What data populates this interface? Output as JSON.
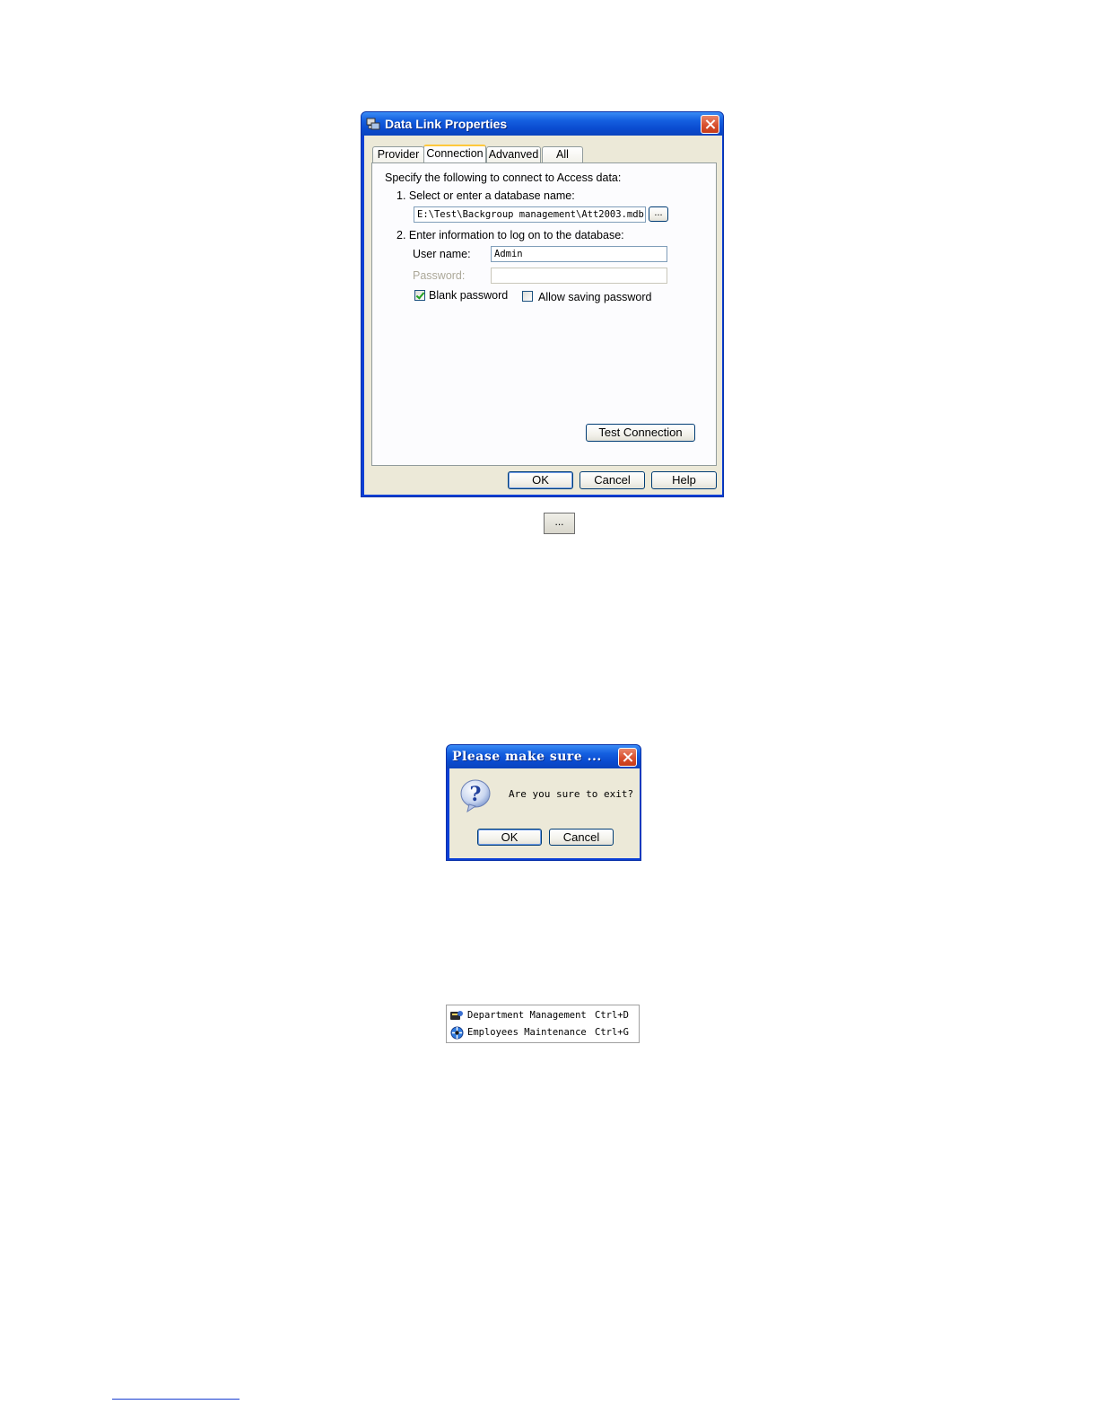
{
  "data_link": {
    "title": "Data Link Properties",
    "tabs": [
      {
        "label": "Provider",
        "active": false
      },
      {
        "label": "Connection",
        "active": true
      },
      {
        "label": "Advanved",
        "active": false
      },
      {
        "label": "All",
        "active": false
      }
    ],
    "intro": "Specify the following to connect to Access data:",
    "step1_label": "1.  Select or enter a database name:",
    "db_path": "E:\\Test\\Backgroup management\\Att2003.mdb",
    "browse_label": "...",
    "step2_label": "2.  Enter information to log on to the database:",
    "username_label": "User name:",
    "username_value": "Admin",
    "password_label": "Password:",
    "password_value": "",
    "blank_password_label": "Blank password",
    "blank_password_checked": true,
    "allow_saving_label": "Allow saving password",
    "allow_saving_checked": false,
    "test_connection_label": "Test Connection",
    "ok_label": "OK",
    "cancel_label": "Cancel",
    "help_label": "Help"
  },
  "standalone_browse_button": {
    "label": "..."
  },
  "confirm_dialog": {
    "title": "Please make sure ...",
    "message": "Are you sure to exit?",
    "ok_label": "OK",
    "cancel_label": "Cancel",
    "icon": "question-icon"
  },
  "menu": {
    "items": [
      {
        "label": "Department Management",
        "shortcut": "Ctrl+D",
        "icon": "department-icon"
      },
      {
        "label": "Employees Maintenance",
        "shortcut": "Ctrl+G",
        "icon": "employees-icon"
      }
    ]
  },
  "colors": {
    "title_bar": "#0a4bd0",
    "dialog_face": "#ece9d8",
    "close_button": "#d8502e",
    "footer_link": "#1a3fd0"
  }
}
